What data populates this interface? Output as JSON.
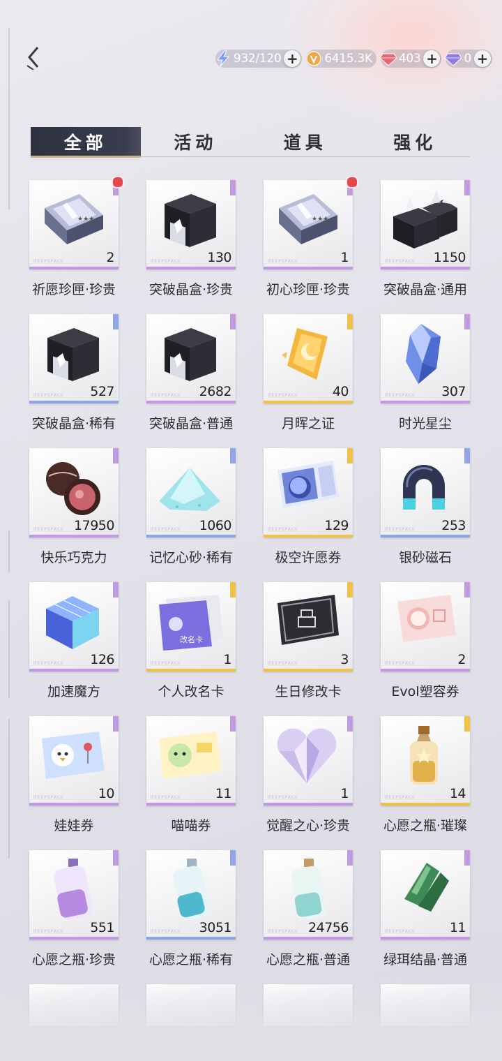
{
  "header": {
    "currencies": [
      {
        "name": "stamina",
        "icon": "stamina-bolt-icon",
        "value": "932/120",
        "color": "#6f8cff"
      },
      {
        "name": "gold",
        "icon": "gold-coin-icon",
        "value": "6415.3K",
        "color": "#e3a246"
      },
      {
        "name": "red-diamond",
        "icon": "red-diamond-icon",
        "value": "403",
        "color": "#e0616c"
      },
      {
        "name": "purple-diamond",
        "icon": "purple-diamond-icon",
        "value": "0",
        "color": "#8b7ad8"
      }
    ],
    "plus_symbol": "+"
  },
  "tabs": [
    {
      "label": "全部",
      "active": true
    },
    {
      "label": "活动",
      "active": false
    },
    {
      "label": "道具",
      "active": false
    },
    {
      "label": "强化",
      "active": false
    }
  ],
  "card_brand": "DEEPSPACE",
  "items": [
    {
      "label": "祈愿珍匣·珍贵",
      "count": "2",
      "rarity": "purple",
      "icon": "wish-box-icon",
      "badge": true
    },
    {
      "label": "突破晶盒·珍贵",
      "count": "130",
      "rarity": "purple",
      "icon": "breakthrough-crystal-box-icon",
      "badge": false
    },
    {
      "label": "初心珍匣·珍贵",
      "count": "1",
      "rarity": "purple",
      "icon": "wish-box-icon",
      "badge": true
    },
    {
      "label": "突破晶盒·通用",
      "count": "1150",
      "rarity": "purple",
      "icon": "breakthrough-crystal-pile-icon",
      "badge": false
    },
    {
      "label": "突破晶盒·稀有",
      "count": "527",
      "rarity": "blue",
      "icon": "breakthrough-crystal-box-icon",
      "badge": false
    },
    {
      "label": "突破晶盒·普通",
      "count": "2682",
      "rarity": "purple",
      "icon": "breakthrough-crystal-box-icon",
      "badge": false
    },
    {
      "label": "月晖之证",
      "count": "40",
      "rarity": "gold",
      "icon": "moon-crest-icon",
      "badge": false
    },
    {
      "label": "时光星尘",
      "count": "307",
      "rarity": "purple",
      "icon": "blue-crystal-icon",
      "badge": false
    },
    {
      "label": "快乐巧克力",
      "count": "17950",
      "rarity": "purple",
      "icon": "chocolate-icon",
      "badge": false
    },
    {
      "label": "记忆心砂·稀有",
      "count": "1060",
      "rarity": "blue",
      "icon": "memory-sand-icon",
      "badge": false
    },
    {
      "label": "极空许愿券",
      "count": "129",
      "rarity": "gold",
      "icon": "wish-ticket-icon",
      "badge": false
    },
    {
      "label": "银砂磁石",
      "count": "253",
      "rarity": "blue",
      "icon": "magnet-icon",
      "badge": false
    },
    {
      "label": "加速魔方",
      "count": "126",
      "rarity": "purple",
      "icon": "cube-icon",
      "badge": false
    },
    {
      "label": "个人改名卡",
      "count": "1",
      "rarity": "gold",
      "icon": "rename-card-icon",
      "badge": false
    },
    {
      "label": "生日修改卡",
      "count": "3",
      "rarity": "gold",
      "icon": "birthday-card-icon",
      "badge": false
    },
    {
      "label": "Evol塑容券",
      "count": "2",
      "rarity": "purple",
      "icon": "evol-coupon-icon",
      "badge": false
    },
    {
      "label": "娃娃券",
      "count": "10",
      "rarity": "purple",
      "icon": "doll-coupon-icon",
      "badge": false
    },
    {
      "label": "喵喵券",
      "count": "11",
      "rarity": "purple",
      "icon": "meow-coupon-icon",
      "badge": false
    },
    {
      "label": "觉醒之心·珍贵",
      "count": "1",
      "rarity": "purple",
      "icon": "crystal-heart-icon",
      "badge": false
    },
    {
      "label": "心愿之瓶·璀璨",
      "count": "14",
      "rarity": "gold",
      "icon": "gold-bottle-icon",
      "badge": false
    },
    {
      "label": "心愿之瓶·珍贵",
      "count": "551",
      "rarity": "purple",
      "icon": "purple-bottle-icon",
      "badge": false
    },
    {
      "label": "心愿之瓶·稀有",
      "count": "3051",
      "rarity": "blue",
      "icon": "blue-bottle-icon",
      "badge": false
    },
    {
      "label": "心愿之瓶·普通",
      "count": "24756",
      "rarity": "purple",
      "icon": "green-bottle-icon",
      "badge": false
    },
    {
      "label": "绿珥结晶·普通",
      "count": "11",
      "rarity": "purple",
      "icon": "green-crystal-icon",
      "badge": false
    }
  ],
  "rarity_colors": {
    "purple": "#c09be0",
    "blue": "#8ea6e6",
    "gold": "#f0c24a"
  }
}
